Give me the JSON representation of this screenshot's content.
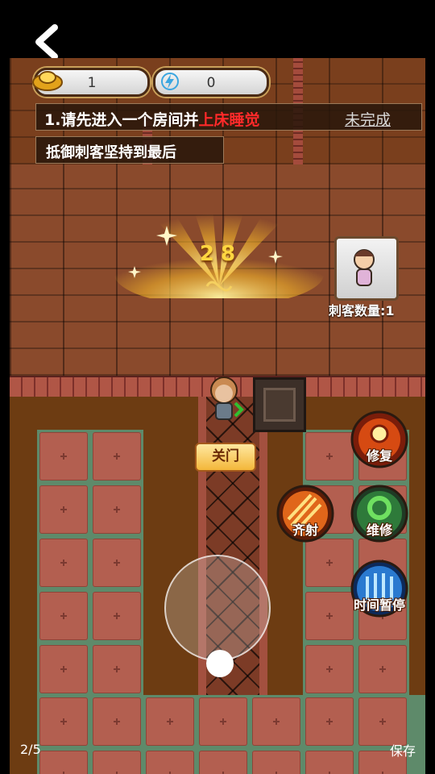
{
  "resources": {
    "gold": "1",
    "energy": "0"
  },
  "quests": {
    "main_prefix": "1.请先进入一个房间并",
    "main_highlight": "上床睡觉",
    "main_status": "未完成",
    "secondary": "抵御刺客坚持到最后"
  },
  "wave": {
    "countdown": "28"
  },
  "assassins": {
    "label": "刺客数量:1"
  },
  "door": {
    "close_label": "关门"
  },
  "skills": {
    "repair": "修复",
    "volley": "齐射",
    "maintain": "维修",
    "time_pause": "时间暂停"
  },
  "viewer": {
    "page": "2/5",
    "save": "保存"
  },
  "colors": {
    "quest_highlight": "#ff2a2a",
    "timer": "#ffd640",
    "button_gold": "#f3b73a"
  }
}
